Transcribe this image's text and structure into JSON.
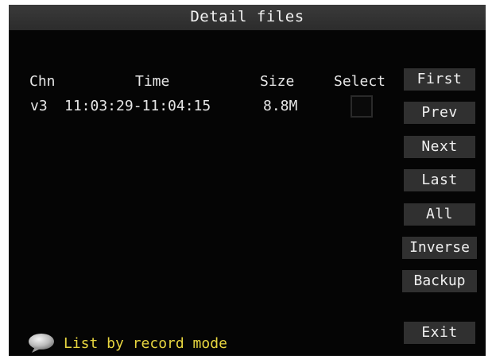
{
  "title": "Detail files",
  "columns": {
    "channel": "Chn",
    "time": "Time",
    "size": "Size",
    "select": "Select"
  },
  "files": [
    {
      "channel": "v3",
      "time": "11:03:29-11:04:15",
      "size": "8.8M",
      "selected": false
    }
  ],
  "buttons": {
    "first": "First",
    "prev": "Prev",
    "next": "Next",
    "last": "Last",
    "all": "All",
    "inverse": "Inverse",
    "backup": "Backup",
    "exit": "Exit"
  },
  "status": {
    "icon": "speech-bubble-icon",
    "text": "List by record mode"
  },
  "colors": {
    "background": "#050505",
    "button": "#303030",
    "status_text": "#e8d640"
  }
}
